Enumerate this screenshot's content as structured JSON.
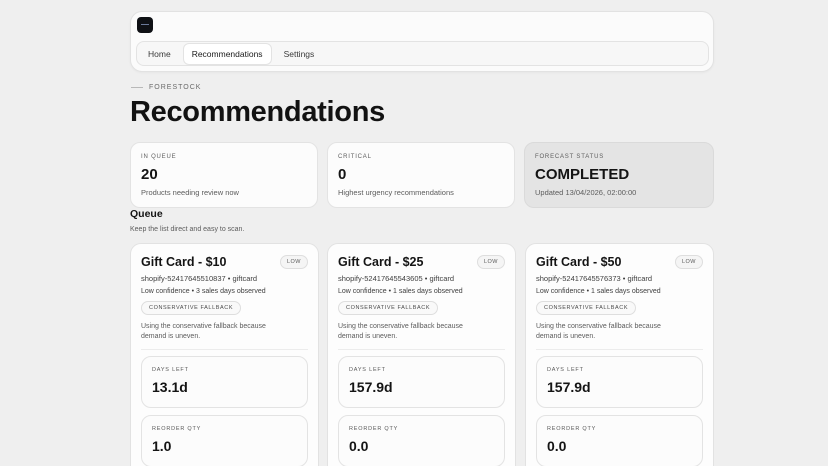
{
  "nav": {
    "tabs": [
      "Home",
      "Recommendations",
      "Settings"
    ],
    "active_tab": "Recommendations"
  },
  "header": {
    "eyebrow": "FORESTOCK",
    "title": "Recommendations"
  },
  "stats": [
    {
      "label": "IN QUEUE",
      "value": "20",
      "sub": "Products needing review now"
    },
    {
      "label": "CRITICAL",
      "value": "0",
      "sub": "Highest urgency recommendations"
    },
    {
      "label": "FORECAST STATUS",
      "value": "COMPLETED",
      "sub": "Updated 13/04/2026, 02:00:00"
    }
  ],
  "queue": {
    "title": "Queue",
    "subtitle": "Keep the list direct and easy to scan."
  },
  "cards": [
    {
      "title": "Gift Card - $10",
      "badge": "LOW",
      "sku": "shopify-52417645510837 • giftcard",
      "confidence": "Low confidence • 3 sales days observed",
      "tag": "CONSERVATIVE FALLBACK",
      "note": "Using the conservative fallback because demand is uneven.",
      "days_label": "DAYS LEFT",
      "days_value": "13.1d",
      "reorder_label": "REORDER QTY",
      "reorder_value": "1.0"
    },
    {
      "title": "Gift Card - $25",
      "badge": "LOW",
      "sku": "shopify-52417645543605 • giftcard",
      "confidence": "Low confidence • 1 sales days observed",
      "tag": "CONSERVATIVE FALLBACK",
      "note": "Using the conservative fallback because demand is uneven.",
      "days_label": "DAYS LEFT",
      "days_value": "157.9d",
      "reorder_label": "REORDER QTY",
      "reorder_value": "0.0"
    },
    {
      "title": "Gift Card - $50",
      "badge": "LOW",
      "sku": "shopify-52417645576373 • giftcard",
      "confidence": "Low confidence • 1 sales days observed",
      "tag": "CONSERVATIVE FALLBACK",
      "note": "Using the conservative fallback because demand is uneven.",
      "days_label": "DAYS LEFT",
      "days_value": "157.9d",
      "reorder_label": "REORDER QTY",
      "reorder_value": "0.0"
    }
  ]
}
